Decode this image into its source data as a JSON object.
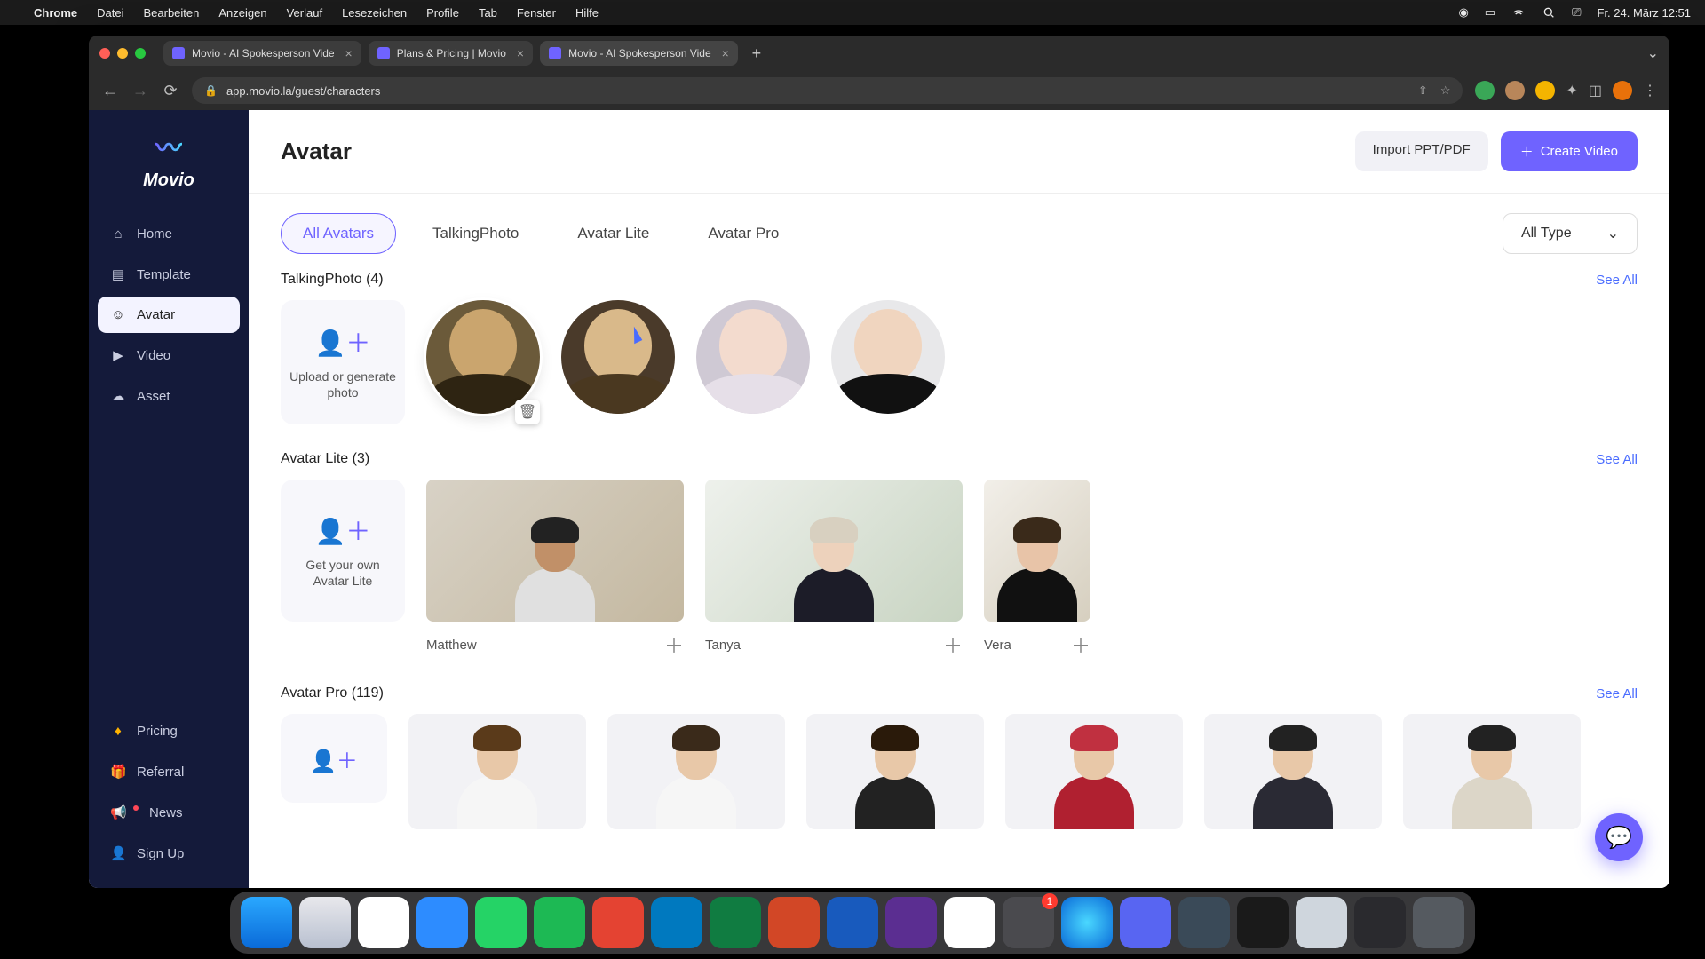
{
  "mac_menu": {
    "app": "Chrome",
    "items": [
      "Datei",
      "Bearbeiten",
      "Anzeigen",
      "Verlauf",
      "Lesezeichen",
      "Profile",
      "Tab",
      "Fenster",
      "Hilfe"
    ],
    "clock": "Fr. 24. März  12:51"
  },
  "browser": {
    "tabs": [
      {
        "title": "Movio - AI Spokesperson Vide"
      },
      {
        "title": "Plans & Pricing | Movio"
      },
      {
        "title": "Movio - AI Spokesperson Vide"
      }
    ],
    "url": "app.movio.la/guest/characters"
  },
  "sidebar": {
    "brand": "Movio",
    "nav": [
      {
        "key": "home",
        "label": "Home",
        "icon": "⌂"
      },
      {
        "key": "template",
        "label": "Template",
        "icon": "▤"
      },
      {
        "key": "avatar",
        "label": "Avatar",
        "icon": "☺",
        "active": true
      },
      {
        "key": "video",
        "label": "Video",
        "icon": "▶"
      },
      {
        "key": "asset",
        "label": "Asset",
        "icon": "☁"
      }
    ],
    "bottom": [
      {
        "key": "pricing",
        "label": "Pricing",
        "icon": "♦",
        "color": "#ffb300"
      },
      {
        "key": "referral",
        "label": "Referral",
        "icon": "🎁"
      },
      {
        "key": "news",
        "label": "News",
        "icon": "📢",
        "dot": true
      },
      {
        "key": "signup",
        "label": "Sign Up",
        "icon": "👤"
      }
    ]
  },
  "header": {
    "title": "Avatar",
    "import": "Import PPT/PDF",
    "create": "Create Video"
  },
  "filters": {
    "chips": [
      "All Avatars",
      "TalkingPhoto",
      "Avatar Lite",
      "Avatar Pro"
    ],
    "active": 0,
    "type_select": "All Type"
  },
  "sections": {
    "talkingphoto": {
      "title": "TalkingPhoto (4)",
      "see_all": "See All",
      "upload": "Upload or generate photo",
      "items": [
        {
          "name": "mona-lisa",
          "bg": "#6b5a3a",
          "skin": "#caa56e",
          "hair": "#2e2412"
        },
        {
          "name": "shakespeare",
          "bg": "#4a3a2a",
          "skin": "#d9b98a",
          "hair": "#4a3820"
        },
        {
          "name": "cg-female",
          "bg": "#cfc9d4",
          "skin": "#f3dbce",
          "hair": "#e6dfe8"
        },
        {
          "name": "cg-male",
          "bg": "#e8e8ea",
          "skin": "#f0d5bf",
          "hair": "#111"
        }
      ]
    },
    "lite": {
      "title": "Avatar Lite (3)",
      "see_all": "See All",
      "upload": "Get your own Avatar Lite",
      "items": [
        {
          "name": "Matthew",
          "bg": "linear-gradient(135deg,#d8d2c6,#c4b8a0)",
          "skin": "#c19068",
          "shirt": "#e0e0e0"
        },
        {
          "name": "Tanya",
          "bg": "linear-gradient(135deg,#eef1ec,#c8d4c2)",
          "skin": "#edd2bc",
          "shirt": "#1c1c28"
        },
        {
          "name": "Vera",
          "bg": "linear-gradient(135deg,#f2efe9,#d6cfbf)",
          "skin": "#e8c4a8",
          "shirt": "#111"
        }
      ]
    },
    "pro": {
      "title": "Avatar Pro (119)",
      "see_all": "See All",
      "items": [
        {
          "hair": "#5a3a1a",
          "shirt": "#f6f6f6"
        },
        {
          "hair": "#3a2a1a",
          "shirt": "#f6f6f6"
        },
        {
          "hair": "#2a1a0a",
          "shirt": "#222"
        },
        {
          "hair": "#5a2a1a",
          "shirt": "#b02030",
          "hat": "#c03040"
        },
        {
          "hair": "#222",
          "shirt": "#2a2a34"
        },
        {
          "hair": "#222",
          "shirt": "#dcd6c8"
        }
      ]
    }
  },
  "dock": {
    "items": [
      {
        "name": "finder",
        "bg": "linear-gradient(#2aa8ff,#0a6ad8)"
      },
      {
        "name": "safari",
        "bg": "linear-gradient(#e8e8ec,#b8c0d0)"
      },
      {
        "name": "chrome",
        "bg": "#fff"
      },
      {
        "name": "zoom",
        "bg": "#2d8cff"
      },
      {
        "name": "whatsapp",
        "bg": "#25d366"
      },
      {
        "name": "spotify",
        "bg": "#1db954"
      },
      {
        "name": "todoist",
        "bg": "#e44332"
      },
      {
        "name": "trello",
        "bg": "#0079bf"
      },
      {
        "name": "excel",
        "bg": "#107c41"
      },
      {
        "name": "powerpoint",
        "bg": "#d24726"
      },
      {
        "name": "word",
        "bg": "#185abd"
      },
      {
        "name": "imovie",
        "bg": "#5b2e91"
      },
      {
        "name": "drive",
        "bg": "#fff"
      },
      {
        "name": "settings",
        "bg": "#4a4a4e",
        "badge": "1"
      },
      {
        "name": "siri",
        "bg": "radial-gradient(circle,#4ad8ff,#0a6ad8)"
      },
      {
        "name": "discord",
        "bg": "#5865f2"
      },
      {
        "name": "quicktime",
        "bg": "#3a4a58"
      },
      {
        "name": "audio",
        "bg": "#1a1a1a"
      },
      {
        "name": "preview",
        "bg": "#cfd6dd"
      },
      {
        "name": "mission",
        "bg": "#2a2a2e"
      },
      {
        "name": "trash",
        "bg": "#555a60"
      }
    ]
  },
  "colors": {
    "accent": "#6f63ff"
  }
}
